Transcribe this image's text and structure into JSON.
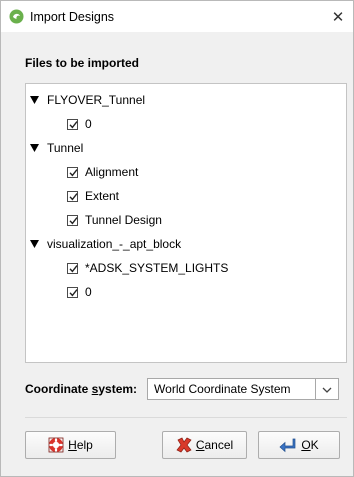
{
  "window": {
    "title": "Import Designs",
    "close_glyph": "✕",
    "app_icon": "leapfrog-app-icon"
  },
  "files": {
    "heading": "Files to be imported",
    "tree": [
      {
        "label": "FLYOVER_Tunnel",
        "expanded": true,
        "children": [
          {
            "label": "0",
            "checked": true
          }
        ]
      },
      {
        "label": "Tunnel",
        "expanded": true,
        "children": [
          {
            "label": "Alignment",
            "checked": true
          },
          {
            "label": "Extent",
            "checked": true
          },
          {
            "label": "Tunnel Design",
            "checked": true
          }
        ]
      },
      {
        "label": "visualization_-_apt_block",
        "expanded": true,
        "children": [
          {
            "label": "*ADSK_SYSTEM_LIGHTS",
            "checked": true
          },
          {
            "label": "0",
            "checked": true
          }
        ]
      }
    ]
  },
  "coordinate_system": {
    "label_before": "Coordinate ",
    "label_mnemonic": "s",
    "label_after": "ystem:",
    "value": "World Coordinate System",
    "arrow_icon": "chevron-down-icon"
  },
  "buttons": {
    "help": {
      "mnemonic": "H",
      "rest": "elp",
      "icon": "lifebuoy-icon"
    },
    "cancel": {
      "mnemonic": "C",
      "rest": "ancel",
      "icon": "red-x-icon"
    },
    "ok": {
      "mnemonic": "O",
      "rest": "K",
      "icon": "enter-arrow-icon"
    }
  },
  "colors": {
    "app_icon_green": "#6ab04c",
    "help_red": "#d9332b",
    "cancel_red": "#d93a2b",
    "ok_blue": "#3a73c4"
  }
}
